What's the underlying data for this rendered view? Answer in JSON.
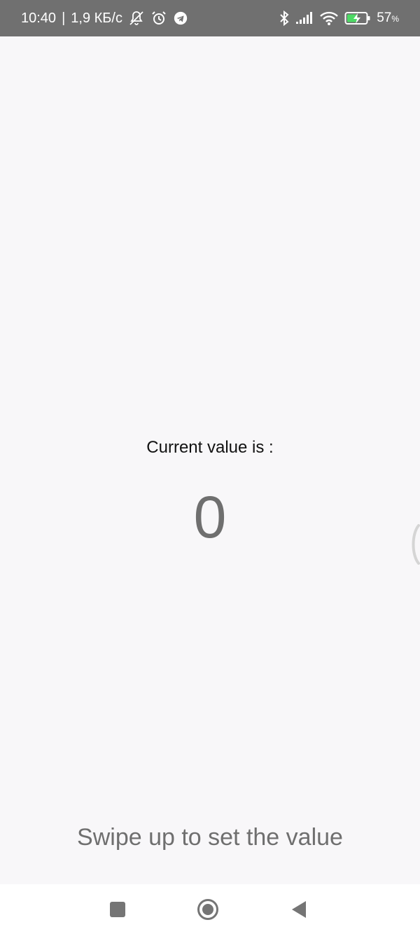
{
  "status_bar": {
    "time": "10:40",
    "separator": "|",
    "net_speed": "1,9 КБ/с",
    "icons_left": [
      "notifications-off-icon",
      "alarm-icon",
      "telegram-icon"
    ],
    "icons_right": [
      "bluetooth-icon",
      "signal-icon",
      "wifi-icon",
      "battery-charging-icon"
    ],
    "battery_percent": "57",
    "battery_unit": "%",
    "battery_level": 0.57
  },
  "main": {
    "current_label": "Current value is :",
    "current_value": "0",
    "swipe_hint": "Swipe up to set the value"
  },
  "nav_bar": {
    "buttons": [
      "recents-icon",
      "home-icon",
      "back-icon"
    ]
  },
  "colors": {
    "background": "#f8f7f9",
    "status_bar": "#707070",
    "value_text": "#6f6f6f",
    "battery_fill": "#4cd964",
    "nav_icons": "#757575"
  }
}
